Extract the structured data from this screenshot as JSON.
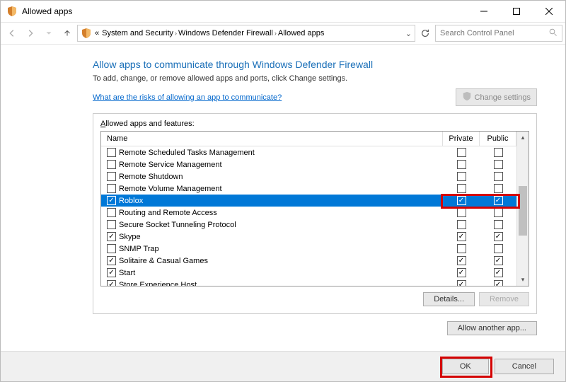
{
  "window": {
    "title": "Allowed apps"
  },
  "breadcrumb": {
    "prefix": "«",
    "items": [
      "System and Security",
      "Windows Defender Firewall",
      "Allowed apps"
    ]
  },
  "search": {
    "placeholder": "Search Control Panel"
  },
  "page": {
    "title": "Allow apps to communicate through Windows Defender Firewall",
    "subtitle": "To add, change, or remove allowed apps and ports, click Change settings.",
    "risks_link": "What are the risks of allowing an app to communicate?",
    "change_settings": "Change settings"
  },
  "group": {
    "label_prefix": "A",
    "label_rest": "llowed apps and features:",
    "col_name": "Name",
    "col_private": "Private",
    "col_public": "Public"
  },
  "apps": [
    {
      "name": "Remote Scheduled Tasks Management",
      "enabled": false,
      "private": false,
      "public": false,
      "selected": false
    },
    {
      "name": "Remote Service Management",
      "enabled": false,
      "private": false,
      "public": false,
      "selected": false
    },
    {
      "name": "Remote Shutdown",
      "enabled": false,
      "private": false,
      "public": false,
      "selected": false
    },
    {
      "name": "Remote Volume Management",
      "enabled": false,
      "private": false,
      "public": false,
      "selected": false
    },
    {
      "name": "Roblox",
      "enabled": true,
      "private": true,
      "public": true,
      "selected": true
    },
    {
      "name": "Routing and Remote Access",
      "enabled": false,
      "private": false,
      "public": false,
      "selected": false
    },
    {
      "name": "Secure Socket Tunneling Protocol",
      "enabled": false,
      "private": false,
      "public": false,
      "selected": false
    },
    {
      "name": "Skype",
      "enabled": true,
      "private": true,
      "public": true,
      "selected": false
    },
    {
      "name": "SNMP Trap",
      "enabled": false,
      "private": false,
      "public": false,
      "selected": false
    },
    {
      "name": "Solitaire & Casual Games",
      "enabled": true,
      "private": true,
      "public": true,
      "selected": false
    },
    {
      "name": "Start",
      "enabled": true,
      "private": true,
      "public": true,
      "selected": false
    },
    {
      "name": "Store Experience Host",
      "enabled": true,
      "private": true,
      "public": true,
      "selected": false
    }
  ],
  "buttons": {
    "details": "Details...",
    "remove": "Remove",
    "allow_another": "Allow another app...",
    "ok": "OK",
    "cancel": "Cancel"
  }
}
